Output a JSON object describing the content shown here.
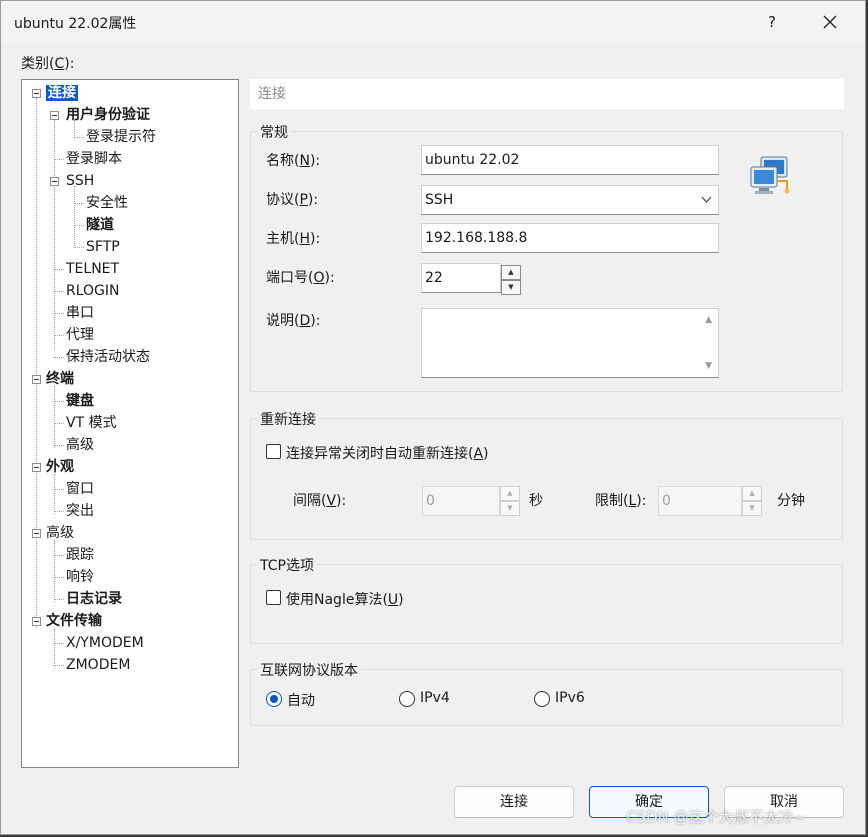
{
  "window": {
    "title": "ubuntu 22.02属性",
    "help_label": "?"
  },
  "category": {
    "label_prefix": "类别(",
    "label_key": "C",
    "label_suffix": "):"
  },
  "tree": [
    {
      "label": "连接",
      "bold": true,
      "selected": true
    },
    {
      "label": "用户身份验证",
      "bold": true
    },
    {
      "label": "登录提示符"
    },
    {
      "label": "登录脚本"
    },
    {
      "label": "SSH"
    },
    {
      "label": "安全性"
    },
    {
      "label": "隧道",
      "bold": true
    },
    {
      "label": "SFTP"
    },
    {
      "label": "TELNET"
    },
    {
      "label": "RLOGIN"
    },
    {
      "label": "串口"
    },
    {
      "label": "代理"
    },
    {
      "label": "保持活动状态"
    },
    {
      "label": "终端",
      "bold": true
    },
    {
      "label": "键盘",
      "bold": true
    },
    {
      "label": "VT 模式"
    },
    {
      "label": "高级"
    },
    {
      "label": "外观",
      "bold": true
    },
    {
      "label": "窗口"
    },
    {
      "label": "突出"
    },
    {
      "label": "高级"
    },
    {
      "label": "跟踪"
    },
    {
      "label": "响铃"
    },
    {
      "label": "日志记录",
      "bold": true
    },
    {
      "label": "文件传输",
      "bold": true
    },
    {
      "label": "X/YMODEM"
    },
    {
      "label": "ZMODEM"
    }
  ],
  "header": {
    "title": "连接"
  },
  "general": {
    "title": "常规",
    "name_label_prefix": "名称(",
    "name_label_key": "N",
    "name_label_suffix": "):",
    "name_value": "ubuntu 22.02",
    "protocol_label_prefix": "协议(",
    "protocol_label_key": "P",
    "protocol_label_suffix": "):",
    "protocol_value": "SSH",
    "host_label_prefix": "主机(",
    "host_label_key": "H",
    "host_label_suffix": "):",
    "host_value": "192.168.188.8",
    "port_label_prefix": "端口号(",
    "port_label_key": "O",
    "port_label_suffix": "):",
    "port_value": "22",
    "desc_label_prefix": "说明(",
    "desc_label_key": "D",
    "desc_label_suffix": "):",
    "desc_value": ""
  },
  "reconnect": {
    "title": "重新连接",
    "checkbox_label_prefix": "连接异常关闭时自动重新连接(",
    "checkbox_key": "A",
    "checkbox_suffix": ")",
    "checked": false,
    "interval_label_prefix": "间隔(",
    "interval_key": "V",
    "interval_suffix": "):",
    "interval_value": "0",
    "interval_unit": "秒",
    "limit_label_prefix": "限制(",
    "limit_key": "L",
    "limit_suffix": "):",
    "limit_value": "0",
    "limit_unit": "分钟"
  },
  "tcp": {
    "title": "TCP选项",
    "nagle_prefix": "使用Nagle算法(",
    "nagle_key": "U",
    "nagle_suffix": ")",
    "checked": false
  },
  "ip": {
    "title": "互联网协议版本",
    "options": [
      "自动",
      "IPv4",
      "IPv6"
    ],
    "selected": "自动"
  },
  "buttons": {
    "connect": "连接",
    "ok": "确定",
    "cancel": "取消"
  },
  "watermark": "CSDN @这个大叔不太冷~",
  "colors": {
    "accent": "#0a59c6",
    "window_bg": "#f0f0f0"
  }
}
